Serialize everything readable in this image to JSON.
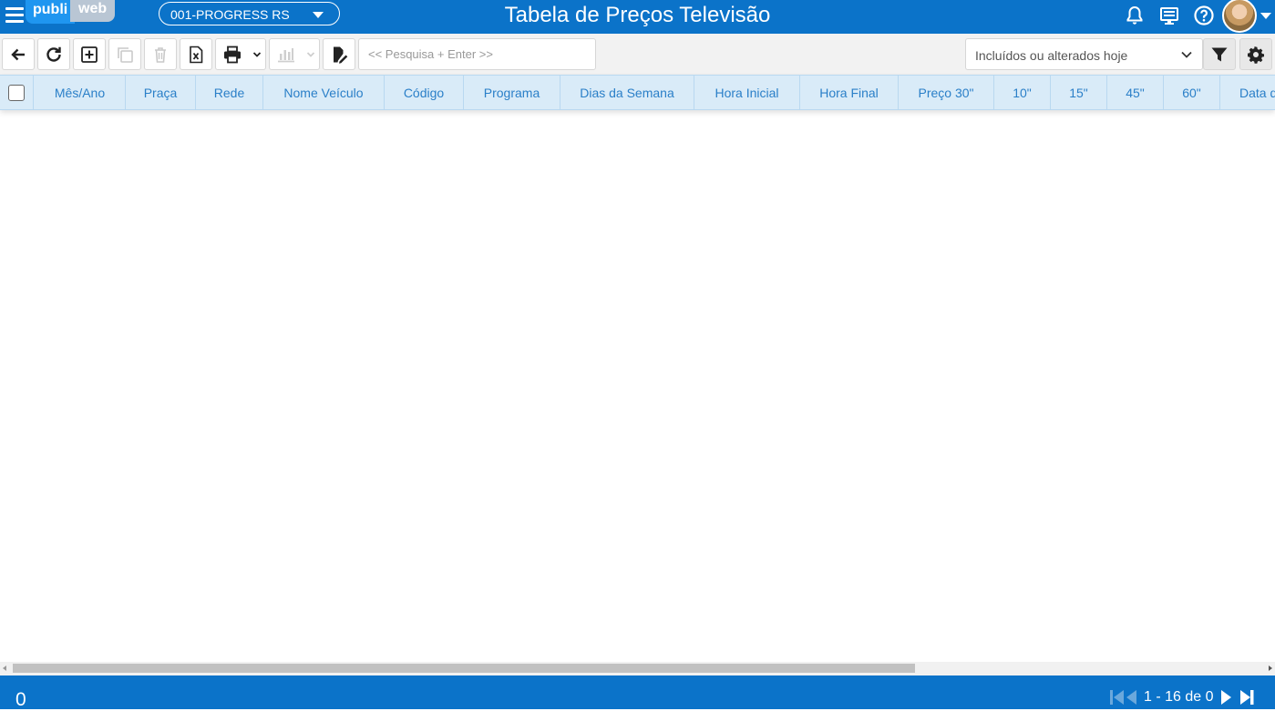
{
  "app": {
    "logo_part1": "publi",
    "logo_part2": "web",
    "company_select": "001-PROGRESS RS",
    "title": "Tabela de Preços Televisão"
  },
  "toolbar": {
    "search_placeholder": "<< Pesquisa + Enter >>",
    "filter_select": "Incluídos ou alterados hoje"
  },
  "grid": {
    "columns": [
      "Mês/Ano",
      "Praça",
      "Rede",
      "Nome Veículo",
      "Código",
      "Programa",
      "Dias da Semana",
      "Hora Inicial",
      "Hora Final",
      "Preço 30\"",
      "10\"",
      "15\"",
      "45\"",
      "60\"",
      "Data de"
    ]
  },
  "footer": {
    "record_count": "0",
    "pagination": "1 - 16 de 0"
  },
  "colors": {
    "brand_blue": "#0b73c9",
    "header_bg": "#d9ebf8",
    "header_text": "#2a7fc8"
  }
}
